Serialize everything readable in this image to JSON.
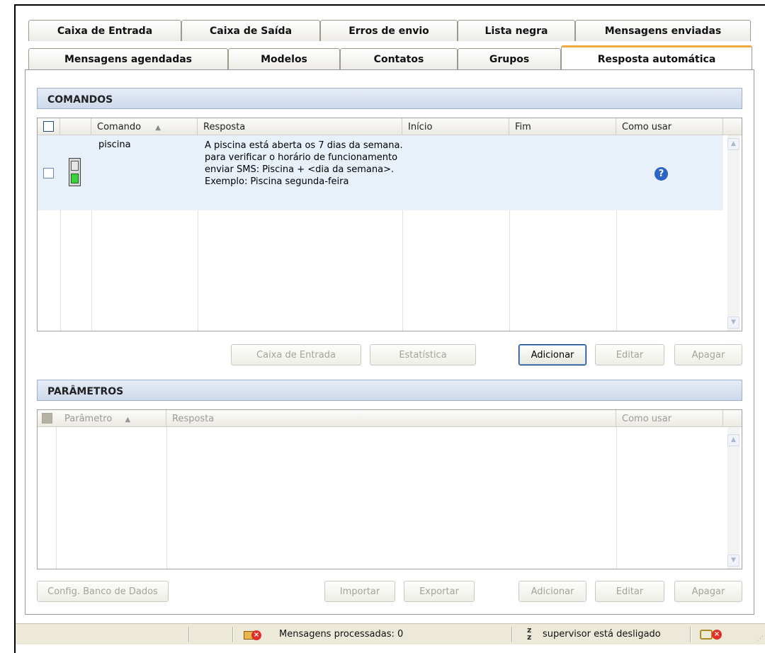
{
  "tabs_row1": [
    "Caixa de Entrada",
    "Caixa de Saída",
    "Erros de envio",
    "Lista negra",
    "Mensagens enviadas"
  ],
  "tabs_row2": [
    "Mensagens agendadas",
    "Modelos",
    "Contatos",
    "Grupos",
    "Resposta automática"
  ],
  "active_tab": "Resposta automática",
  "commands": {
    "title": "COMANDOS",
    "columns": {
      "command": "Comando",
      "response": "Resposta",
      "start": "Início",
      "end": "Fim",
      "how_to_use": "Como usar"
    },
    "sort_indicator": "▲",
    "rows": [
      {
        "command": "piscina",
        "response": "A piscina está aberta os 7 dias da semana. para verificar o horário de funcionamento enviar SMS: Piscina + <dia da semana>. Exemplo: Piscina segunda-feira",
        "start": "",
        "end": "",
        "status_icon": "traffic-light-green-icon",
        "how_to_use_icon": "help-question-icon"
      }
    ],
    "buttons": {
      "inbox": "Caixa de Entrada",
      "stats": "Estatística",
      "add": "Adicionar",
      "edit": "Editar",
      "delete": "Apagar"
    }
  },
  "parameters": {
    "title": "PARÂMETROS",
    "columns": {
      "parameter": "Parâmetro",
      "response": "Resposta",
      "how_to_use": "Como usar"
    },
    "sort_indicator": "▲",
    "buttons": {
      "db_config": "Config. Banco de Dados",
      "import": "Importar",
      "export": "Exportar",
      "add": "Adicionar",
      "edit": "Editar",
      "delete": "Apagar"
    }
  },
  "status_bar": {
    "messages_processed": "Mensagens processadas: 0",
    "supervisor": "supervisor está desligado"
  },
  "colors": {
    "active_tab_accent": "#f0a93c",
    "selected_row": "#e8f0fa",
    "group_header": "#cdd9ec",
    "help_icon": "#2b66c2"
  }
}
